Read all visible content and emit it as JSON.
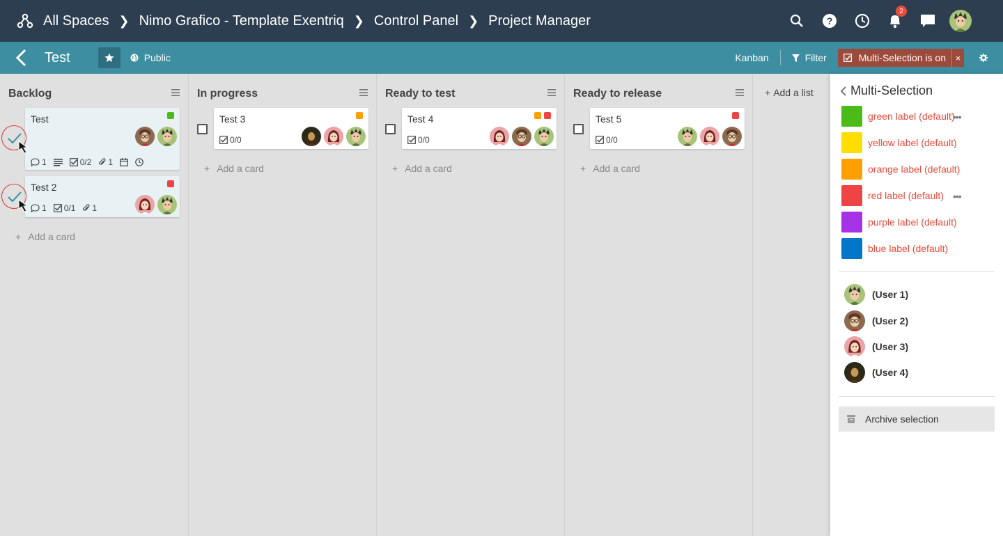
{
  "breadcrumb": [
    "All Spaces",
    "Nimo Grafico - Template Exentriq",
    "Control Panel",
    "Project Manager"
  ],
  "notifications_count": "2",
  "board": {
    "title": "Test",
    "visibility": "Public",
    "view": "Kanban",
    "filter": "Filter",
    "multi_selection": "Multi-Selection is on",
    "multi_close": "×"
  },
  "lists": [
    {
      "title": "Backlog"
    },
    {
      "title": "In progress"
    },
    {
      "title": "Ready to test"
    },
    {
      "title": "Ready to release"
    }
  ],
  "cards": {
    "test": {
      "title": "Test",
      "comments": "1",
      "checklist": "0/2",
      "attachments": "1"
    },
    "test2": {
      "title": "Test 2",
      "comments": "1",
      "checklist": "0/1",
      "attachments": "1"
    },
    "test3": {
      "title": "Test 3",
      "checklist": "0/0"
    },
    "test4": {
      "title": "Test 4",
      "checklist": "0/0"
    },
    "test5": {
      "title": "Test 5",
      "checklist": "0/0"
    }
  },
  "add_card": "Add a card",
  "add_list": "Add a list",
  "panel": {
    "title": "Multi-Selection",
    "labels": [
      {
        "name": "green label (default)",
        "color": "#4cbb17"
      },
      {
        "name": "yellow label (default)",
        "color": "#ffdd00"
      },
      {
        "name": "orange label (default)",
        "color": "#ff9f00"
      },
      {
        "name": "red label (default)",
        "color": "#ef4444"
      },
      {
        "name": "purple label (default)",
        "color": "#a632e6"
      },
      {
        "name": "blue label (default)",
        "color": "#0077c8"
      }
    ],
    "users": [
      "(User 1)",
      "(User 2)",
      "(User 3)",
      "(User 4)"
    ],
    "archive": "Archive selection"
  },
  "colors": {
    "topbar": "#2c3e50",
    "boardbar": "#3c8ea0",
    "multi_selection": "#9b4a3c",
    "label_green": "#4cbb17",
    "label_orange": "#ff9f00",
    "label_red": "#ef4444"
  }
}
